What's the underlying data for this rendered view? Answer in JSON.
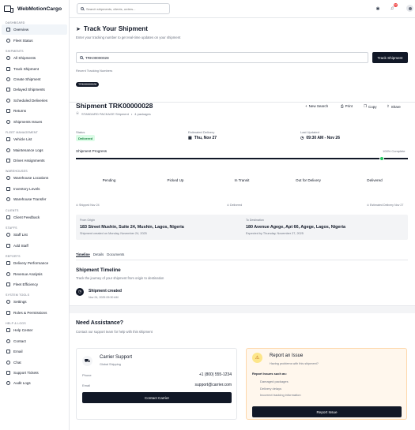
{
  "brand": "WebMotionCargo",
  "sidebar": {
    "sections": [
      {
        "title": "DASHBOARD",
        "items": [
          "Overview",
          "Fleet Status"
        ]
      },
      {
        "title": "SHIPMENTS",
        "items": [
          "All Shipments",
          "Track Shipment",
          "Create Shipment",
          "Delayed Shipments",
          "Scheduled Deliveries",
          "Returns",
          "Shipments Issues"
        ]
      },
      {
        "title": "FLEET MANAGEMENT",
        "items": [
          "Vehicle List",
          "Maintenance Logs",
          "Driver Assignments"
        ]
      },
      {
        "title": "WAREHOUSES",
        "items": [
          "Warehouse Locations",
          "Inventory Levels",
          "Warehouse Transfer"
        ]
      },
      {
        "title": "CLIENTS",
        "items": [
          "Client Feedback"
        ]
      },
      {
        "title": "STAFFS",
        "items": [
          "Staff List",
          "Add Staff"
        ]
      },
      {
        "title": "REPORTS",
        "items": [
          "Delivery Performance",
          "Revenue Analysis",
          "Fleet Efficiency"
        ]
      },
      {
        "title": "SYSTEM TOOLS",
        "items": [
          "Settings",
          "Roles & Permissions"
        ]
      },
      {
        "title": "HELP & LOGS",
        "items": [
          "Help Center",
          "Contact",
          "Email",
          "Chat",
          "Support Tickets",
          "Audit Logs"
        ]
      }
    ],
    "active": "Overview"
  },
  "topbar": {
    "search_placeholder": "Search shipments, clients, orders...",
    "notif_count": "10"
  },
  "track": {
    "title": "Track Your Shipment",
    "subtitle": "Enter your tracking number to get real-time updates on your shipment",
    "input_value": "TRK00000028",
    "button": "Track Shipment",
    "recent_label": "Recent Tracking Numbers",
    "recent": [
      "TRK00000028"
    ]
  },
  "shipment": {
    "title": "Shipment TRK00000028",
    "meta": "STANDARD PACKAGE Shipment",
    "packages": "4 packages",
    "actions": [
      "New Search",
      "Print",
      "Copy",
      "Share"
    ],
    "status_label": "Status",
    "status": "Delivered",
    "est_label": "Estimated Delivery",
    "est": "Thu, Nov 27",
    "updated_label": "Last Updated",
    "updated": "09:30 AM - Nov 26",
    "progress_label": "Shipment Progress",
    "progress_text": "100% Complete",
    "progress": 1.0,
    "steps": [
      "Pending",
      "Picked Up",
      "In Transit",
      "Out for Delivery",
      "Delivered"
    ],
    "foot_left": "Shipped Nov 24",
    "foot_mid": "Delivered",
    "foot_right": "Estimated Delivery Nov 27",
    "origin_label": "From Origin",
    "origin": "183 Street Mushin, Suite 24, Mushin, Lagos, Nigeria",
    "origin_note": "Shipment created on Monday, November 24, 2025",
    "dest_label": "To Destination",
    "dest": "180 Avenue Agege, Apt 66, Agege, Lagos, Nigeria",
    "dest_note": "Expected by Thursday, November 27, 2025",
    "tabs": [
      "Timeline",
      "Details",
      "Documents"
    ],
    "timeline_title": "Shipment Timeline",
    "timeline_sub": "Track the journey of your shipment from origin to destination",
    "event_title": "Shipment created",
    "event_time": "Nov 24, 2025 09:30 AM"
  },
  "assist": {
    "title": "Need Assistance?",
    "subtitle": "Contact our support team for help with this shipment",
    "carrier_title": "Carrier Support",
    "carrier_sub": "Global Shipping",
    "phone_label": "Phone",
    "phone": "+1 (800) 555-1234",
    "email_label": "Email",
    "email": "support@carrier.com",
    "carrier_btn": "Contact Carrier",
    "report_title": "Report an Issue",
    "report_sub": "Having problems with this shipment?",
    "report_list_label": "Report issues such as:",
    "report_list": [
      "Damaged packages",
      "Delivery delays",
      "Incorrect tracking information"
    ],
    "report_btn": "Report Issue"
  },
  "colors": {
    "accent": "#111827",
    "success": "#22c55e",
    "status_bg": "#dcfce7",
    "status_fg": "#15803d",
    "report_bg": "#fff7ed"
  }
}
